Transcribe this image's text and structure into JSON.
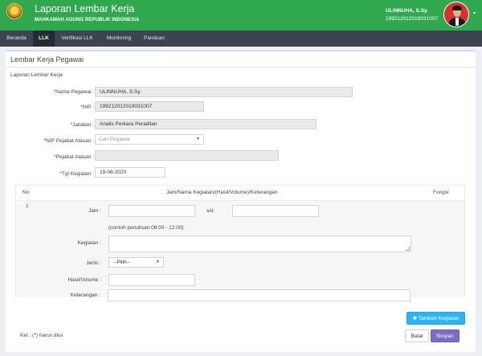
{
  "header": {
    "title": "Laporan Lembar Kerja",
    "subtitle": "MAHKAMAH AGUNG REPUBLIK INDONESIA",
    "user_name": "ULINNUHA, S.Sy.",
    "user_nip": "199212012019031007",
    "caret": "▾"
  },
  "nav": {
    "items": [
      "Beranda",
      "LLK",
      "Verifikasi LLK",
      "Monitoring",
      "Panduan"
    ],
    "active": "LLK"
  },
  "panel": {
    "title": "Lembar Kerja Pegawai",
    "section": "Laporan Lembar Kerja"
  },
  "form": {
    "nama_label": "*Nama Pegawai :",
    "nama_value": "ULINNUHA, S.Sy.",
    "nip_label": "*NIP :",
    "nip_value": "199212012019031007",
    "jabatan_label": "*Jabatan :",
    "jabatan_value": "Analis Perkara Peradilan",
    "nip_atasan_label": "*NIP Pejabat Atasan :",
    "nip_atasan_placeholder": "Cari Pegawai",
    "pejabat_label": "*Pejabat Atasan :",
    "pejabat_value": "",
    "tgl_label": "*Tgl Kegiatan :",
    "tgl_value": "19-06-2020"
  },
  "table": {
    "headers": {
      "no": "No",
      "main": "Jam/Nama Kegiatan/(Hasil/Volume)/Keterangan",
      "fungsi": "Fungsi"
    },
    "row": {
      "no": "1",
      "jam_label": "Jam :",
      "sd_label": "s/d",
      "jam_start": "",
      "jam_end": "",
      "jam_hint": "(contoh penulisan 08:00 - 12:00)",
      "kegiatan_label": "Kegiatan :",
      "kegiatan_value": "",
      "jenis_label": "Jenis :",
      "jenis_selected": "--Pilih--",
      "hasil_label": "Hasil/Volume :",
      "hasil_value": "",
      "keterangan_label": "Keterangan :",
      "keterangan_value": ""
    }
  },
  "actions": {
    "tambah_label": "Tambah Kegiatan",
    "tambah_icon": "plus-icon",
    "batal_label": "Batal",
    "simpan_label": "Simpan"
  },
  "footnote": "Ket : (*) harus diisi",
  "colors": {
    "header_green": "#2fa84f",
    "navbar": "#3b4450",
    "tambah_button": "#29b6f6",
    "simpan_button": "#7e6bc4"
  }
}
